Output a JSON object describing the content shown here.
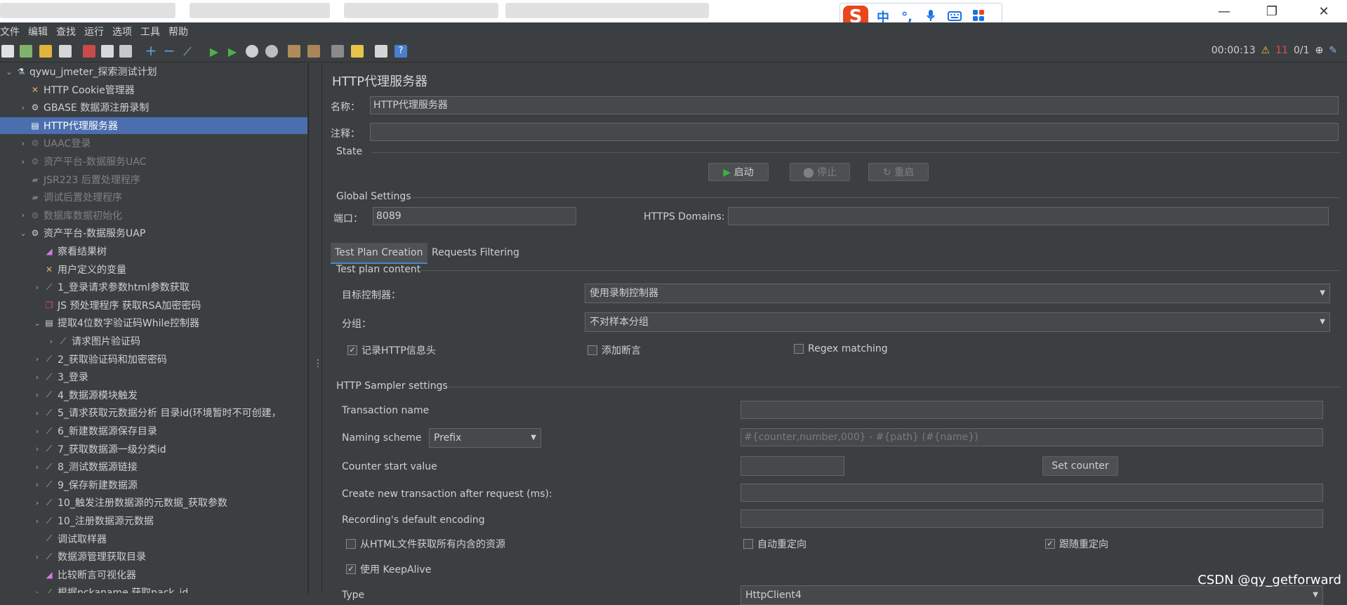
{
  "ime": {
    "logo": "S",
    "items": [
      "中",
      "°,",
      "mic-icon",
      "keyboard-icon",
      "apps-icon"
    ]
  },
  "window": {
    "minimize": "—",
    "restore": "❐",
    "close": "✕"
  },
  "menu": [
    "文件",
    "编辑",
    "查找",
    "运行",
    "选项",
    "工具",
    "帮助"
  ],
  "status": {
    "timer": "00:00:13",
    "warnings": "11",
    "threads": "0/1"
  },
  "tree": {
    "nodes": [
      {
        "label": "qywu_jmeter_探索测试计划",
        "level": 0,
        "arrow": "v",
        "icon": "flask-icon",
        "state": "normal"
      },
      {
        "label": "HTTP Cookie管理器",
        "level": 1,
        "arrow": "",
        "icon": "wrench-icon",
        "state": "normal"
      },
      {
        "label": "GBASE 数据源注册录制",
        "level": 1,
        "arrow": ">",
        "icon": "gear-icon",
        "state": "normal"
      },
      {
        "label": "HTTP代理服务器",
        "level": 1,
        "arrow": "",
        "icon": "proxy-icon",
        "state": "selected"
      },
      {
        "label": "UAAC登录",
        "level": 1,
        "arrow": ">",
        "icon": "gear-icon",
        "state": "disabled"
      },
      {
        "label": "资产平台-数据服务UAC",
        "level": 1,
        "arrow": ">",
        "icon": "gear-icon",
        "state": "disabled"
      },
      {
        "label": "JSR223 后置处理程序",
        "level": 1,
        "arrow": "",
        "icon": "script-icon",
        "state": "disabled"
      },
      {
        "label": "调试后置处理程序",
        "level": 1,
        "arrow": "",
        "icon": "script-icon",
        "state": "disabled"
      },
      {
        "label": "数据库数据初始化",
        "level": 1,
        "arrow": ">",
        "icon": "gear-icon",
        "state": "disabled"
      },
      {
        "label": "资产平台-数据服务UAP",
        "level": 1,
        "arrow": "v",
        "icon": "gear-icon",
        "state": "normal"
      },
      {
        "label": "察看结果树",
        "level": 2,
        "arrow": "",
        "icon": "chart-icon",
        "state": "normal"
      },
      {
        "label": "用户定义的变量",
        "level": 2,
        "arrow": "",
        "icon": "wrench-icon",
        "state": "normal"
      },
      {
        "label": "1_登录请求参数html参数获取",
        "level": 2,
        "arrow": ">",
        "icon": "sampler-icon",
        "state": "normal"
      },
      {
        "label": "JS 预处理程序  获取RSA加密密码",
        "level": 2,
        "arrow": "",
        "icon": "js-icon",
        "state": "normal"
      },
      {
        "label": "提取4位数字验证码While控制器",
        "level": 2,
        "arrow": "v",
        "icon": "controller-icon",
        "state": "normal"
      },
      {
        "label": "请求图片验证码",
        "level": 3,
        "arrow": ">",
        "icon": "sampler-icon",
        "state": "normal"
      },
      {
        "label": "2_获取验证码和加密密码",
        "level": 2,
        "arrow": ">",
        "icon": "sampler-icon",
        "state": "normal"
      },
      {
        "label": "3_登录",
        "level": 2,
        "arrow": ">",
        "icon": "sampler-icon",
        "state": "normal"
      },
      {
        "label": "4_数据源模块触发",
        "level": 2,
        "arrow": ">",
        "icon": "sampler-icon",
        "state": "normal"
      },
      {
        "label": "5_请求获取元数据分析 目录id(环境暂时不可创建，",
        "level": 2,
        "arrow": ">",
        "icon": "sampler-icon",
        "state": "normal"
      },
      {
        "label": "6_新建数据源保存目录",
        "level": 2,
        "arrow": ">",
        "icon": "sampler-icon",
        "state": "normal"
      },
      {
        "label": "7_获取数据源一级分类id",
        "level": 2,
        "arrow": ">",
        "icon": "sampler-icon",
        "state": "normal"
      },
      {
        "label": "8_测试数据源链接",
        "level": 2,
        "arrow": ">",
        "icon": "sampler-icon",
        "state": "normal"
      },
      {
        "label": "9_保存新建数据源",
        "level": 2,
        "arrow": ">",
        "icon": "sampler-icon",
        "state": "normal"
      },
      {
        "label": "10_触发注册数据源的元数据_获取参数",
        "level": 2,
        "arrow": ">",
        "icon": "sampler-icon",
        "state": "normal"
      },
      {
        "label": "10_注册数据源元数据",
        "level": 2,
        "arrow": ">",
        "icon": "sampler-icon",
        "state": "normal"
      },
      {
        "label": "调试取样器",
        "level": 2,
        "arrow": "",
        "icon": "sampler-icon",
        "state": "normal"
      },
      {
        "label": "数据源管理获取目录",
        "level": 2,
        "arrow": ">",
        "icon": "sampler-icon",
        "state": "normal"
      },
      {
        "label": "比较断言可视化器",
        "level": 2,
        "arrow": "",
        "icon": "chart-icon",
        "state": "normal"
      },
      {
        "label": "根据pckaname 获取pack_id",
        "level": 2,
        "arrow": ">",
        "icon": "sampler-icon",
        "state": "normal"
      }
    ]
  },
  "panel": {
    "title": "HTTP代理服务器",
    "name_label": "名称：",
    "name_value": "HTTP代理服务器",
    "comment_label": "注释：",
    "comment_value": "",
    "state_label": "State",
    "start": "启动",
    "stop": "停止",
    "restart": "重启",
    "global_label": "Global Settings",
    "port_label": "端口：",
    "port_value": "8089",
    "https_label": "HTTPS Domains:",
    "https_value": "",
    "tabs": [
      "Test Plan Creation",
      "Requests Filtering"
    ],
    "content_label": "Test plan content",
    "target_label": "目标控制器：",
    "target_value": "使用录制控制器",
    "group_label": "分组：",
    "group_value": "不对样本分组",
    "chk_headers": "记录HTTP信息头",
    "chk_assert": "添加断言",
    "chk_regex": "Regex matching",
    "sampler_label": "HTTP Sampler settings",
    "trans_name": "Transaction name",
    "naming_scheme": "Naming scheme",
    "naming_value": "Prefix",
    "naming_placeholder": "#{counter,number,000} - #{path} (#{name})",
    "counter_start": "Counter start value",
    "set_counter": "Set counter",
    "new_trans": "Create new transaction after request (ms):",
    "rec_enc": "Recording's default encoding",
    "chk_fetch": "从HTML文件获取所有内含的资源",
    "chk_auto": "自动重定向",
    "chk_follow": "跟随重定向",
    "chk_keepalive": "使用 KeepAlive",
    "type_label": "Type",
    "type_value": "HttpClient4"
  },
  "watermark": "CSDN @qy_getforward"
}
